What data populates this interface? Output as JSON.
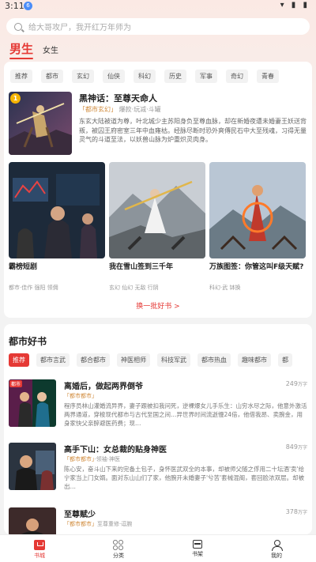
{
  "status_bar": {
    "time": "3:11",
    "notif": "6",
    "icons": "▾ ▮ ▮"
  },
  "search": {
    "placeholder": "给大哥攻尸，我开红万年师为"
  },
  "gender_tabs": [
    "男生",
    "女生"
  ],
  "categories": [
    "推荐",
    "都市",
    "玄幻",
    "仙侠",
    "科幻",
    "历史",
    "军事",
    "奇幻",
    "青春"
  ],
  "featured": {
    "rank": "1",
    "title": "黑神话：至尊天命人",
    "rank_tag": "「都市玄幻」",
    "tags": "爆款·玩减·斗罐",
    "desc": "东玄大陆被道为尊，叶北城少主苏阳身负至尊血脉，却在新婚夜遭未婚妻王妖送背叛，被囚王府密室三年中血雍枯。经脉尽断时恐外爽傳民石中大至残魂，习得无量灵气的斗道至法，以妖兽山脉为炉重炽灵肉身。"
  },
  "grid_books": [
    {
      "title": "霸榜短剧",
      "sub": "都市·佳作 强阳 领佣"
    },
    {
      "title": "我在雪山签到三千年",
      "sub": "玄幻 仙幻 无敌 行阴"
    },
    {
      "title": "万族图签：你管这叫F级天赋?",
      "sub": "科幻·武 钵换"
    }
  ],
  "more_link": "换一批好书 >",
  "city_section": {
    "title": "都市好书",
    "tabs": [
      "推荐",
      "都市言武",
      "都合都市",
      "神医相师",
      "科技军武",
      "都市热血",
      "趣味都市",
      "都"
    ],
    "books": [
      {
        "tag": "都市",
        "title": "离婚后，做起两界倒爷",
        "words": "249",
        "unit": "万字",
        "rank": "「都市都市」",
        "meta": "",
        "desc": "程序员林山灌婚流异界，妻子跟被扣我问死，逆裸爆女儿手乐生：山穷水尽之际，他意外激活两界通道，穿梭现代都市与古代至国之间…异世界时间流逝慢24倍，他借我昂、卖腕金，用身家快父亲醉避医药费；现…"
      },
      {
        "title": "高手下山：女总裁的贴身神医",
        "words": "849",
        "unit": "万字",
        "rank": "「都市都市」",
        "meta": "·领袖·神医",
        "desc": "陈心安，奋斗山下来的完备土包子，身怀医武双全的本事，却被师父随之俘用二十坛酒'卖'给宁家当上门女婿。面对东山山们了家，他腕开未婚妻子'兮苦'套械混阁，套回脸浓双层。却被出…"
      },
      {
        "title": "至尊赋少",
        "words": "378",
        "unit": "万字",
        "rank": "「都市都市」",
        "meta": "至尊重修·逗腕",
        "desc": ""
      }
    ]
  },
  "bottom_nav": [
    "书城",
    "分类",
    "书架",
    "我的"
  ],
  "colors": {
    "accent": "#e53935",
    "rank": "#d08a3a"
  }
}
